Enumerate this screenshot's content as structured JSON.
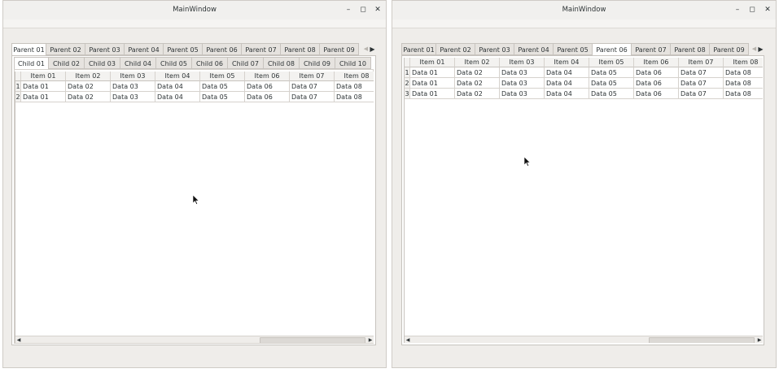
{
  "windows": [
    {
      "title": "MainWindow",
      "parent_tabs": [
        "Parent 01",
        "Parent 02",
        "Parent 03",
        "Parent 04",
        "Parent 05",
        "Parent 06",
        "Parent 07",
        "Parent 08",
        "Parent 09"
      ],
      "active_parent": "Parent 01",
      "child_tabs": [
        "Child 01",
        "Child 02",
        "Child 03",
        "Child 04",
        "Child 05",
        "Child 06",
        "Child 07",
        "Child 08",
        "Child 09",
        "Child 10"
      ],
      "active_child": "Child 01",
      "columns": [
        "Item 01",
        "Item 02",
        "Item 03",
        "Item 04",
        "Item 05",
        "Item 06",
        "Item 07",
        "Item 08"
      ],
      "rows": [
        {
          "num": "1",
          "cells": [
            "Data 01",
            "Data 02",
            "Data 03",
            "Data 04",
            "Data 05",
            "Data 06",
            "Data 07",
            "Data 08"
          ]
        },
        {
          "num": "2",
          "cells": [
            "Data 01",
            "Data 02",
            "Data 03",
            "Data 04",
            "Data 05",
            "Data 06",
            "Data 07",
            "Data 08"
          ]
        }
      ]
    },
    {
      "title": "MainWindow",
      "parent_tabs": [
        "Parent 01",
        "Parent 02",
        "Parent 03",
        "Parent 04",
        "Parent 05",
        "Parent 06",
        "Parent 07",
        "Parent 08",
        "Parent 09"
      ],
      "active_parent": "Parent 06",
      "columns": [
        "Item 01",
        "Item 02",
        "Item 03",
        "Item 04",
        "Item 05",
        "Item 06",
        "Item 07",
        "Item 08"
      ],
      "rows": [
        {
          "num": "1",
          "cells": [
            "Data 01",
            "Data 02",
            "Data 03",
            "Data 04",
            "Data 05",
            "Data 06",
            "Data 07",
            "Data 08"
          ]
        },
        {
          "num": "2",
          "cells": [
            "Data 01",
            "Data 02",
            "Data 03",
            "Data 04",
            "Data 05",
            "Data 06",
            "Data 07",
            "Data 08"
          ]
        },
        {
          "num": "3",
          "cells": [
            "Data 01",
            "Data 02",
            "Data 03",
            "Data 04",
            "Data 05",
            "Data 06",
            "Data 07",
            "Data 08"
          ]
        }
      ]
    }
  ],
  "icons": {
    "minimize": "minimize-icon",
    "maximize": "maximize-icon",
    "close": "close-icon",
    "scroll_left": "chevron-left-icon",
    "scroll_right": "chevron-right-icon",
    "cursor": "mouse-cursor-icon"
  }
}
